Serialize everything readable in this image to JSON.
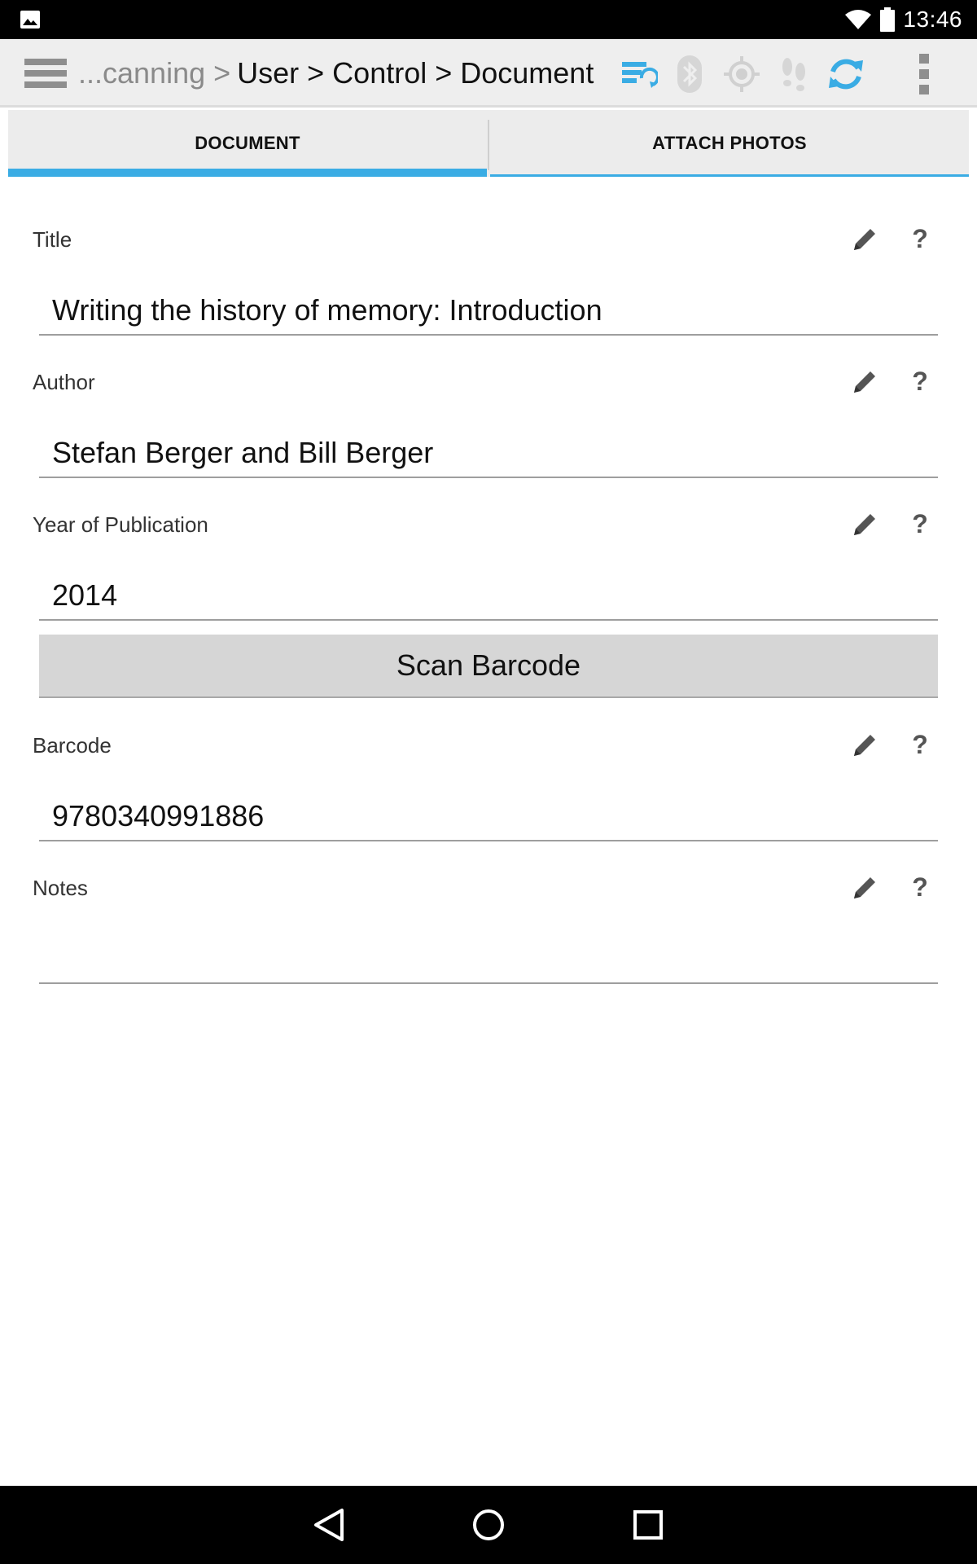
{
  "status_bar": {
    "time": "13:46",
    "icons": [
      "image-notification-icon",
      "wifi-icon",
      "battery-icon"
    ]
  },
  "action_bar": {
    "breadcrumb_prefix": "...canning > ",
    "breadcrumb_current": "User > Control > Document",
    "icons": [
      "menu-icon",
      "sync-server-icon",
      "bluetooth-icon",
      "gps-target-icon",
      "footsteps-icon",
      "refresh-icon",
      "overflow-menu-icon"
    ],
    "accent_color": "#3aace4"
  },
  "tabs": [
    {
      "label": "DOCUMENT",
      "active": true
    },
    {
      "label": "ATTACH PHOTOS",
      "active": false
    }
  ],
  "form": {
    "fields": [
      {
        "label": "Title",
        "value": "Writing the history of memory: Introduction"
      },
      {
        "label": "Author",
        "value": "Stefan Berger and Bill Berger"
      },
      {
        "label": "Year of Publication",
        "value": "2014"
      },
      {
        "label": "Barcode",
        "value": "9780340991886"
      },
      {
        "label": "Notes",
        "value": ""
      }
    ],
    "help_symbol": "?",
    "scan_button_label": "Scan Barcode"
  },
  "nav_bar": {
    "icons": [
      "back-icon",
      "home-icon",
      "recents-icon"
    ]
  }
}
